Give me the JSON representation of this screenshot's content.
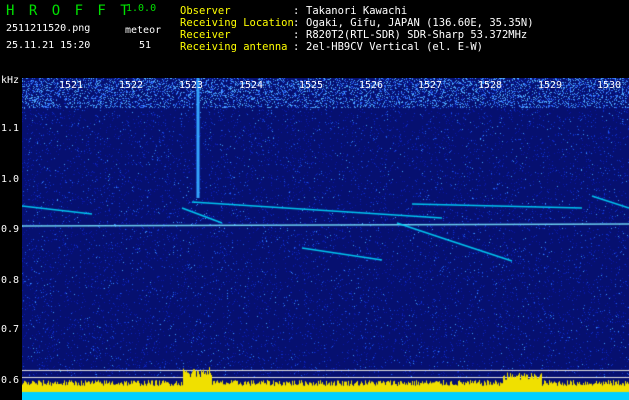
{
  "header": {
    "app_title": "H R O F F T",
    "app_version": "1.0.0",
    "filename": "2511211520.png",
    "meteor_label": "meteor",
    "datetime": "25.11.21 15:20",
    "meteor_count": "51",
    "info": [
      {
        "key": "Observer",
        "value": "Takanori Kawachi"
      },
      {
        "key": "Receiving Location",
        "value": "Ogaki, Gifu, JAPAN (136.60E, 35.35N)"
      },
      {
        "key": "Receiver",
        "value": "R820T2(RTL-SDR) SDR-Sharp 53.372MHz"
      },
      {
        "key": "Receiving antenna",
        "value": "2el-HB9CV Vertical (el. E-W)"
      }
    ],
    "separator": ":"
  },
  "axes": {
    "y_unit": "kHz",
    "y_ticks": [
      "1.1",
      "1.0",
      "0.9",
      "0.8",
      "0.7",
      "0.6"
    ],
    "x_ticks": [
      "1521",
      "1522",
      "1523",
      "1524",
      "1525",
      "1526",
      "1527",
      "1528",
      "1529",
      "1530"
    ]
  },
  "colors": {
    "background": "#000000",
    "title_green": "#00e000",
    "key_yellow": "#ffff00",
    "noise_blue": "#0a1a9a",
    "trace_cyan": "#00e0ff",
    "strip_yellow": "#f0e000"
  }
}
